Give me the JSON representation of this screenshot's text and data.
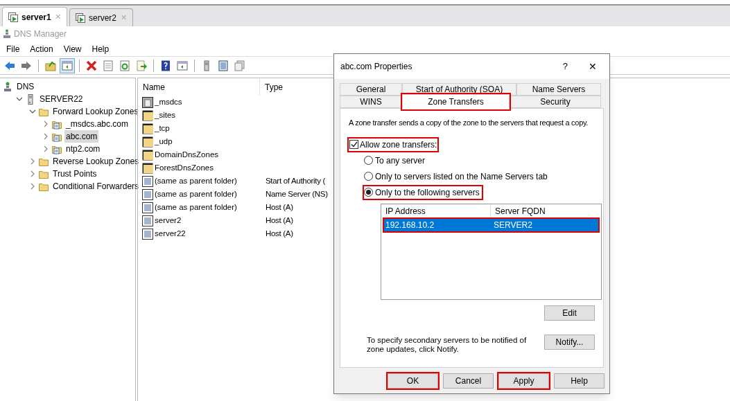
{
  "browser_tabs": [
    {
      "label": "server1",
      "selected": true,
      "close": "✕"
    },
    {
      "label": "server2",
      "selected": false,
      "close": "✕"
    }
  ],
  "window": {
    "title": "DNS Manager"
  },
  "menu": [
    "File",
    "Action",
    "View",
    "Help"
  ],
  "toolbar": [
    {
      "kind": "back"
    },
    {
      "kind": "forward"
    },
    {
      "kind": "separator"
    },
    {
      "kind": "up"
    },
    {
      "kind": "pane",
      "selected": true
    },
    {
      "kind": "separator"
    },
    {
      "kind": "delete"
    },
    {
      "kind": "properties"
    },
    {
      "kind": "refresh"
    },
    {
      "kind": "export"
    },
    {
      "kind": "separator"
    },
    {
      "kind": "help"
    },
    {
      "kind": "pane"
    },
    {
      "kind": "separator"
    },
    {
      "kind": "server"
    },
    {
      "kind": "list"
    },
    {
      "kind": "copy"
    }
  ],
  "tree": [
    {
      "label": "DNS",
      "kind": "dns",
      "selected": false,
      "children": [
        {
          "label": "SERVER22",
          "kind": "server",
          "selected": false,
          "expanded": true,
          "children": [
            {
              "label": "Forward Lookup Zones",
              "kind": "folder",
              "selected": false,
              "expanded": true,
              "children": [
                {
                  "label": "_msdcs.abc.com",
                  "kind": "zone",
                  "selected": false,
                  "expanded": false
                },
                {
                  "label": "abc.com",
                  "kind": "zone",
                  "selected": true,
                  "expanded": false
                },
                {
                  "label": "ntp2.com",
                  "kind": "zone",
                  "selected": false,
                  "expanded": false
                }
              ]
            },
            {
              "label": "Reverse Lookup Zones",
              "kind": "folder",
              "selected": false,
              "expanded": false
            },
            {
              "label": "Trust Points",
              "kind": "folder",
              "selected": false,
              "expanded": false
            },
            {
              "label": "Conditional Forwarders",
              "kind": "folder",
              "selected": false,
              "expanded": false
            }
          ]
        }
      ]
    }
  ],
  "table": {
    "columns": [
      "Name",
      "Type"
    ],
    "rows": [
      {
        "kind": "delegation",
        "name": "_msdcs"
      },
      {
        "kind": "folder",
        "name": "_sites"
      },
      {
        "kind": "folder",
        "name": "_tcp"
      },
      {
        "kind": "folder",
        "name": "_udp"
      },
      {
        "kind": "folder",
        "name": "DomainDnsZones"
      },
      {
        "kind": "folder",
        "name": "ForestDnsZones"
      },
      {
        "kind": "record",
        "name": "(same as parent folder)",
        "type": "Start of Authority ("
      },
      {
        "kind": "record",
        "name": "(same as parent folder)",
        "type": "Name Server (NS)"
      },
      {
        "kind": "record",
        "name": "(same as parent folder)",
        "type": "Host (A)"
      },
      {
        "kind": "record",
        "name": "server2",
        "type": "Host (A)"
      },
      {
        "kind": "record",
        "name": "server22",
        "type": "Host (A)"
      }
    ]
  },
  "dialog": {
    "title": "abc.com Properties",
    "help": "?",
    "close": "✕",
    "tab_rows": [
      [
        {
          "label": "General",
          "selected": false,
          "highlighted": false
        },
        {
          "label": "Start of Authority (SOA)",
          "selected": false,
          "highlighted": false
        },
        {
          "label": "Name Servers",
          "selected": false,
          "highlighted": false
        }
      ],
      [
        {
          "label": "WINS",
          "selected": false,
          "highlighted": false
        },
        {
          "label": "Zone Transfers",
          "selected": true,
          "highlighted": true
        },
        {
          "label": "Security",
          "selected": false,
          "highlighted": false
        }
      ]
    ],
    "description": "A zone transfer sends a copy of the zone to the servers that request a copy.",
    "allow": {
      "label": "Allow zone transfers:",
      "checked": true,
      "highlighted": true
    },
    "options": [
      {
        "label": "To any server",
        "selected": false,
        "highlighted": false
      },
      {
        "label": "Only to servers listed on the Name Servers tab",
        "selected": false,
        "highlighted": false
      },
      {
        "label": "Only to the following servers",
        "selected": true,
        "highlighted": true
      }
    ],
    "servers": {
      "columns": [
        "IP Address",
        "Server FQDN"
      ],
      "rows": [
        {
          "ip": "192.168.10.2",
          "fqdn": "SERVER2",
          "selected": true,
          "highlighted": true
        }
      ]
    },
    "edit_button": "Edit",
    "notify_text": "To specify secondary servers to be notified of zone updates, click Notify.",
    "notify_button": "Notify...",
    "buttons": [
      {
        "label": "OK",
        "highlighted": true
      },
      {
        "label": "Cancel",
        "highlighted": false
      },
      {
        "label": "Apply",
        "highlighted": true
      },
      {
        "label": "Help",
        "highlighted": false
      }
    ]
  }
}
